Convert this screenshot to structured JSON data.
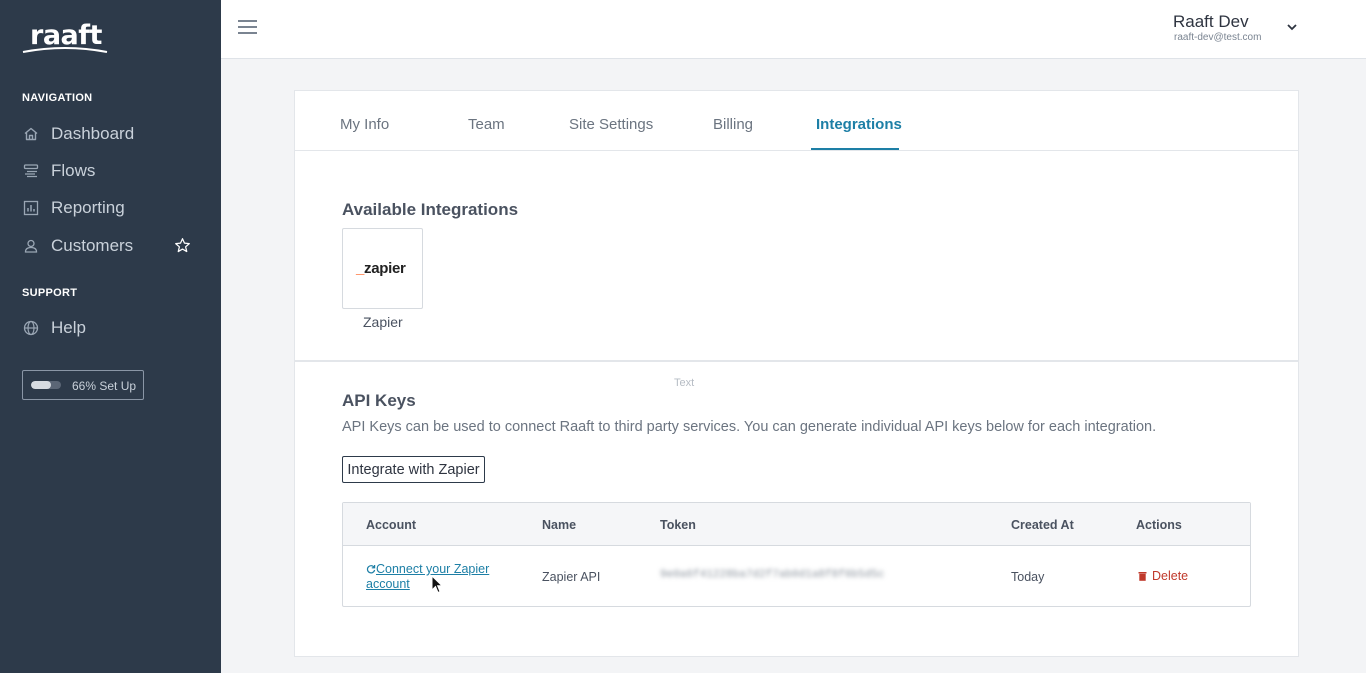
{
  "app": {
    "logo_text": "raaft"
  },
  "sidebar": {
    "navigation_heading": "NAVIGATION",
    "nav_items": [
      {
        "label": "Dashboard",
        "icon": "home-icon"
      },
      {
        "label": "Flows",
        "icon": "flows-icon"
      },
      {
        "label": "Reporting",
        "icon": "reporting-icon"
      },
      {
        "label": "Customers",
        "icon": "user-icon"
      }
    ],
    "support_heading": "SUPPORT",
    "support_items": [
      {
        "label": "Help",
        "icon": "globe-icon"
      }
    ],
    "setup": {
      "label": "66% Set Up",
      "progress": 0.66
    }
  },
  "header": {
    "user_name": "Raaft Dev",
    "user_email": "raaft-dev@test.com"
  },
  "tabs": [
    {
      "label": "My Info",
      "active": false
    },
    {
      "label": "Team",
      "active": false
    },
    {
      "label": "Site Settings",
      "active": false
    },
    {
      "label": "Billing",
      "active": false
    },
    {
      "label": "Integrations",
      "active": true
    }
  ],
  "integrations": {
    "title": "Available Integrations",
    "items": [
      {
        "name": "Zapier",
        "logo_text": "zapier"
      }
    ]
  },
  "placeholder_text": "Text",
  "api_keys": {
    "title": "API Keys",
    "description": "API Keys can be used to connect Raaft to third party services. You can generate individual API keys below for each integration.",
    "integrate_button": "Integrate with Zapier",
    "table": {
      "headers": [
        "Account",
        "Name",
        "Token",
        "Created At",
        "Actions"
      ],
      "rows": [
        {
          "account_link": "Connect your Zapier account",
          "name": "Zapier API",
          "token": "9e0a6f41228ba7d2f7ab0d1a8f8f6b5d5c",
          "created_at": "Today",
          "action": "Delete"
        }
      ]
    }
  },
  "colors": {
    "sidebar_bg": "#2d3a4a",
    "accent": "#1d7fa6",
    "danger": "#c0392b",
    "zapier_orange": "#ff4a00"
  }
}
